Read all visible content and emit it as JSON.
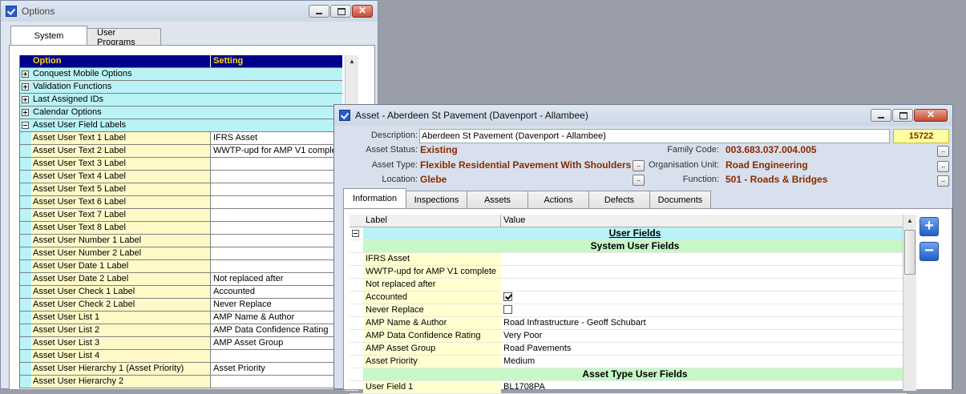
{
  "options_window": {
    "title": "Options",
    "tabs": [
      {
        "label": "System"
      },
      {
        "label": "User Programs"
      }
    ],
    "grid": {
      "col_option": "Option",
      "col_setting": "Setting",
      "groups": [
        {
          "label": "Conquest Mobile Options",
          "expanded": false
        },
        {
          "label": "Validation Functions",
          "expanded": false
        },
        {
          "label": "Last Assigned IDs",
          "expanded": false
        },
        {
          "label": "Calendar Options",
          "expanded": false
        },
        {
          "label": "Asset User Field Labels",
          "expanded": true
        }
      ],
      "rows": [
        {
          "option": "Asset User Text 1 Label",
          "setting": "IFRS Asset"
        },
        {
          "option": "Asset User Text 2 Label",
          "setting": "WWTP-upd for AMP V1 complete"
        },
        {
          "option": "Asset User Text 3 Label",
          "setting": ""
        },
        {
          "option": "Asset User Text 4 Label",
          "setting": ""
        },
        {
          "option": "Asset User Text 5 Label",
          "setting": ""
        },
        {
          "option": "Asset User Text 6 Label",
          "setting": ""
        },
        {
          "option": "Asset User Text 7 Label",
          "setting": ""
        },
        {
          "option": "Asset User Text 8 Label",
          "setting": ""
        },
        {
          "option": "Asset User Number 1 Label",
          "setting": ""
        },
        {
          "option": "Asset User Number 2 Label",
          "setting": ""
        },
        {
          "option": "Asset User Date 1 Label",
          "setting": ""
        },
        {
          "option": "Asset User Date 2 Label",
          "setting": "Not replaced after"
        },
        {
          "option": "Asset User Check 1 Label",
          "setting": "Accounted"
        },
        {
          "option": "Asset User Check 2 Label",
          "setting": "Never Replace"
        },
        {
          "option": "Asset User List 1",
          "setting": "AMP Name & Author"
        },
        {
          "option": "Asset User List 2",
          "setting": "AMP Data Confidence Rating"
        },
        {
          "option": "Asset User List 3",
          "setting": "AMP Asset Group"
        },
        {
          "option": "Asset User List 4",
          "setting": ""
        },
        {
          "option": "Asset User Hierarchy 1 (Asset Priority)",
          "setting": "Asset Priority"
        },
        {
          "option": "Asset User Hierarchy 2",
          "setting": ""
        }
      ]
    }
  },
  "asset_window": {
    "title": "Asset - Aberdeen St Pavement (Davenport - Allambee)",
    "description_label": "Description:",
    "description_value": "Aberdeen St Pavement (Davenport - Allambee)",
    "asset_id": "15722",
    "fields_left": [
      {
        "label": "Asset Status:",
        "value": "Existing"
      },
      {
        "label": "Asset Type:",
        "value": "Flexible Residential Pavement With Shoulders"
      },
      {
        "label": "Location:",
        "value": "Glebe"
      }
    ],
    "fields_right": [
      {
        "label": "Family Code:",
        "value": "003.683.037.004.005"
      },
      {
        "label": "Organisation Unit:",
        "value": "Road Engineering"
      },
      {
        "label": "Function:",
        "value": "501 - Roads & Bridges"
      }
    ],
    "tabs": [
      {
        "label": "Information"
      },
      {
        "label": "Inspections"
      },
      {
        "label": "Assets"
      },
      {
        "label": "Actions"
      },
      {
        "label": "Defects"
      },
      {
        "label": "Documents"
      }
    ],
    "grid": {
      "col_label": "Label",
      "col_value": "Value",
      "user_fields_title": "User Fields",
      "system_section": "System User Fields",
      "system_rows": [
        {
          "label": "IFRS Asset",
          "value": ""
        },
        {
          "label": "WWTP-upd for AMP V1 complete",
          "value": ""
        },
        {
          "label": "Not replaced after",
          "value": ""
        },
        {
          "label": "Accounted",
          "value": "",
          "checkbox": true,
          "checked": true
        },
        {
          "label": "Never Replace",
          "value": "",
          "checkbox": true,
          "checked": false
        },
        {
          "label": "AMP Name & Author",
          "value": "Road Infrastructure - Geoff Schubart"
        },
        {
          "label": "AMP Data Confidence Rating",
          "value": "Very Poor"
        },
        {
          "label": "AMP Asset Group",
          "value": "Road Pavements"
        },
        {
          "label": "Asset Priority",
          "value": "Medium"
        }
      ],
      "asset_type_section": "Asset Type User Fields",
      "asset_type_rows": [
        {
          "label": "User Field 1",
          "value": "BL1708PA"
        }
      ]
    },
    "lookup_glyph": "..",
    "add_glyph": "+",
    "remove_glyph": "−"
  }
}
